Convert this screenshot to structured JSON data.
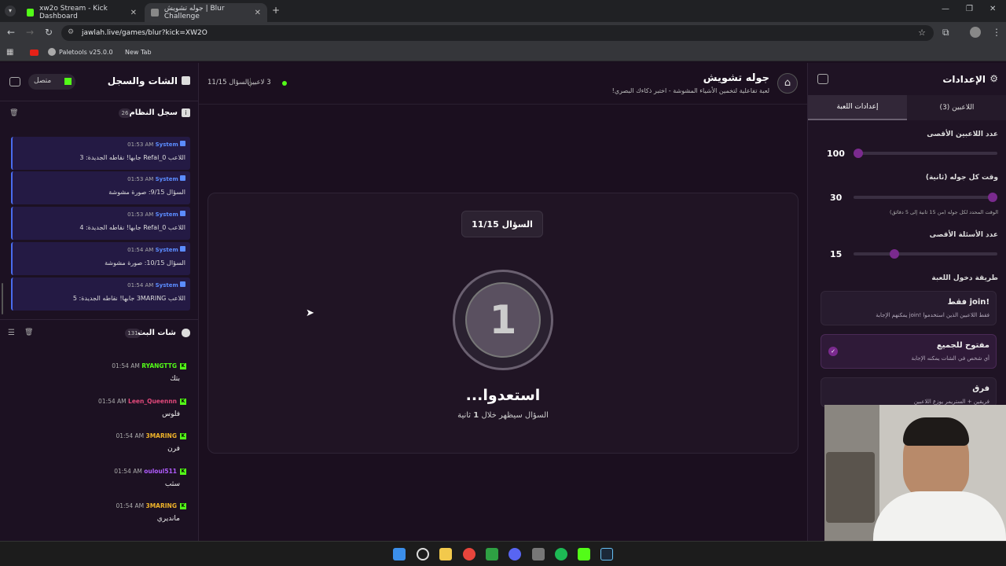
{
  "browser": {
    "tabs": [
      {
        "label": "xw2o Stream - Kick Dashboard",
        "active": false
      },
      {
        "label": "جوله تشويش | Blur Challenge",
        "active": true
      }
    ],
    "url": "jawlah.live/games/blur?kick=XW2O",
    "bookmarks": [
      "Paletools v25.0.0",
      "New Tab"
    ],
    "new_tab_icon": "plus-icon"
  },
  "left_panel": {
    "title": "الشات والسجل",
    "status": "متصل",
    "system_log": {
      "title": "سجل النظام",
      "count": "26",
      "messages": [
        {
          "sender": "System",
          "time": "01:53 AM",
          "text": "اللاعب Refal_0 جابها! نقاطه الجديدة: 3"
        },
        {
          "sender": "System",
          "time": "01:53 AM",
          "text": "السؤال 9/15: صورة مشوشة"
        },
        {
          "sender": "System",
          "time": "01:53 AM",
          "text": "اللاعب Refal_0 جابها! نقاطه الجديدة: 4"
        },
        {
          "sender": "System",
          "time": "01:54 AM",
          "text": "السؤال 10/15: صورة مشوشة"
        },
        {
          "sender": "System",
          "time": "01:54 AM",
          "text": "اللاعب 3MARING جابها! نقاطه الجديدة: 5"
        }
      ]
    },
    "stream_chat": {
      "title": "شات البث",
      "count": "131",
      "messages": [
        {
          "user": "RYANGTTG",
          "color": "#53fc18",
          "time": "01:54 AM",
          "text": "بتك"
        },
        {
          "user": "Leen_Queennn",
          "color": "#e0487a",
          "time": "01:54 AM",
          "text": "فلوس"
        },
        {
          "user": "3MARING",
          "color": "#f0b429",
          "time": "01:54 AM",
          "text": "فرن"
        },
        {
          "user": "ouloul511",
          "color": "#b05cff",
          "time": "01:54 AM",
          "text": "سثب"
        },
        {
          "user": "3MARING",
          "color": "#f0b429",
          "time": "01:54 AM",
          "text": "مانديري"
        }
      ]
    }
  },
  "header": {
    "title": "جوله تشويش",
    "subtitle": "لعبة تفاعلية لتخمين الأشياء المشوشة - اختبر ذكاءك البصري!",
    "players": "3 لاعبين",
    "question": "السؤال 11/15"
  },
  "game": {
    "question_badge": "السؤال 11/15",
    "countdown": "1",
    "ready": "استعدوا...",
    "hint_prefix": "السؤال سيظهر خلال",
    "hint_num": "1",
    "hint_suffix": "ثانية"
  },
  "settings": {
    "title": "الإعدادات",
    "tabs": [
      "اللاعبين (3)",
      "إعدادات اللعبة"
    ],
    "max_players_label": "عدد اللاعبين الأقصى",
    "max_players_value": "100",
    "max_players_fraction": 0.0,
    "round_time_label": "وقت كل جوله (ثانية)",
    "round_time_value": "30",
    "round_time_fraction": 1.0,
    "round_time_hint": "الوقت المحدد لكل جوله (من 15 ثانية إلى 5 دقائق)",
    "max_questions_label": "عدد الأسئلة الأقصى",
    "max_questions_value": "15",
    "max_questions_fraction": 0.27,
    "entry_label": "طريقة دخول اللعبة",
    "options": [
      {
        "title": "!join فقط",
        "desc": "فقط اللاعبين الذين استخدموا !join يمكنهم الإجابة",
        "selected": false
      },
      {
        "title": "مفتوح للجميع",
        "desc": "أي شخص في الشات يمكنه الإجابة",
        "selected": true
      },
      {
        "title": "فرق",
        "desc": "فريقين + الستريمر يوزع اللاعبين",
        "selected": false
      }
    ]
  },
  "colors": {
    "accent": "#7a2a8e",
    "system_blue": "#4a6cf0",
    "online_green": "#53fc18"
  }
}
